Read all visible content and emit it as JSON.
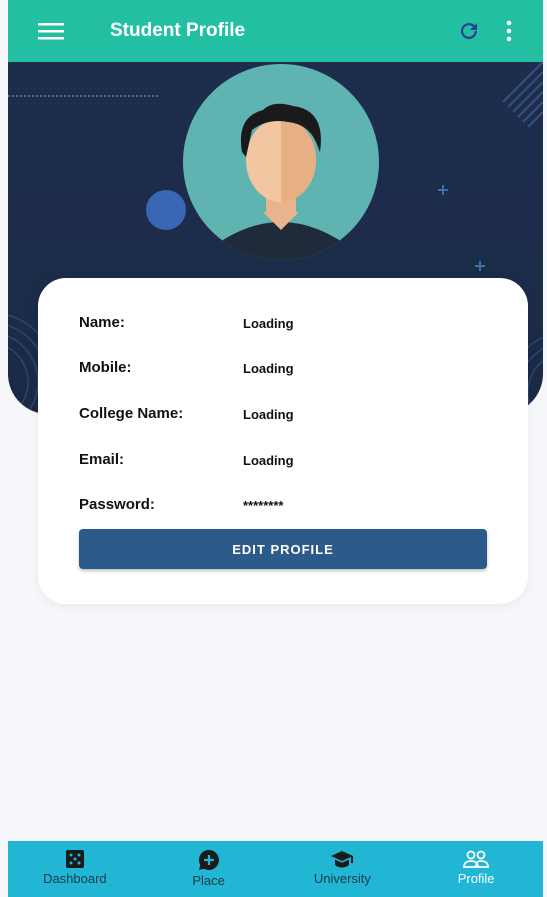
{
  "appbar": {
    "title": "Student Profile",
    "menu_icon": "hamburger-menu-icon",
    "refresh_icon": "refresh-icon",
    "more_icon": "more-vert-icon"
  },
  "profile": {
    "fields": [
      {
        "label": "Name:",
        "value": "Loading"
      },
      {
        "label": "Mobile:",
        "value": "Loading"
      },
      {
        "label": "College Name:",
        "value": "Loading"
      },
      {
        "label": "Email:",
        "value": "Loading"
      },
      {
        "label": "Password:",
        "value": "********"
      }
    ],
    "edit_label": "EDIT PROFILE"
  },
  "nav": {
    "items": [
      {
        "label": "Dashboard",
        "icon": "dashboard-icon"
      },
      {
        "label": "Place",
        "icon": "chat-add-icon"
      },
      {
        "label": "University",
        "icon": "graduation-cap-icon"
      },
      {
        "label": "Profile",
        "icon": "people-icon"
      }
    ],
    "active": "Profile"
  },
  "colors": {
    "appbar": "#22bfa3",
    "hero": "#1d2e4d",
    "button": "#2c5b8b",
    "nav": "#21b6d4"
  }
}
